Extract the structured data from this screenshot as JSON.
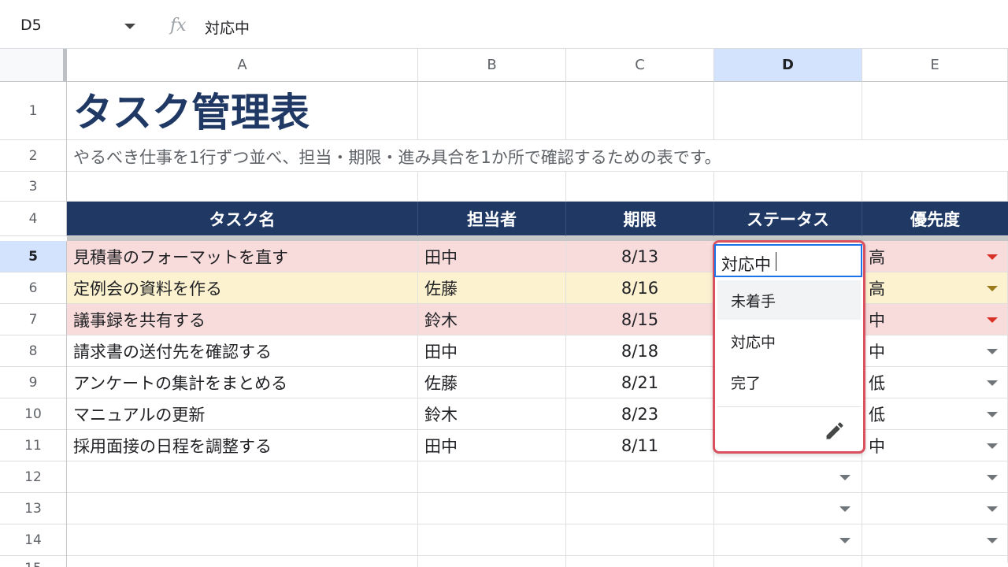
{
  "formula_bar": {
    "cell_ref": "D5",
    "fx_icon": "fx",
    "value": "対応中"
  },
  "columns": [
    "A",
    "B",
    "C",
    "D",
    "E"
  ],
  "selected_column": "D",
  "rows": [
    "1",
    "2",
    "3",
    "4",
    "5",
    "6",
    "7",
    "8",
    "9",
    "10",
    "11",
    "12",
    "13",
    "14",
    "15"
  ],
  "selected_row": "5",
  "sheet": {
    "title": "タスク管理表",
    "description": "やるべき仕事を1行ずつ並べ、担当・期限・進み具合を1か所で確認するための表です。",
    "headers": {
      "task": "タスク名",
      "owner": "担当者",
      "due": "期限",
      "status": "ステータス",
      "priority": "優先度"
    },
    "tasks": [
      {
        "task": "見積書のフォーマットを直す",
        "owner": "田中",
        "due": "8/13",
        "status": "",
        "priority": "高",
        "highlight": "pink"
      },
      {
        "task": "定例会の資料を作る",
        "owner": "佐藤",
        "due": "8/16",
        "status": "",
        "priority": "高",
        "highlight": "yellow"
      },
      {
        "task": "議事録を共有する",
        "owner": "鈴木",
        "due": "8/15",
        "status": "",
        "priority": "中",
        "highlight": "pink"
      },
      {
        "task": "請求書の送付先を確認する",
        "owner": "田中",
        "due": "8/18",
        "status": "",
        "priority": "中",
        "highlight": "none"
      },
      {
        "task": "アンケートの集計をまとめる",
        "owner": "佐藤",
        "due": "8/21",
        "status": "",
        "priority": "低",
        "highlight": "none"
      },
      {
        "task": "マニュアルの更新",
        "owner": "鈴木",
        "due": "8/23",
        "status": "",
        "priority": "低",
        "highlight": "none"
      },
      {
        "task": "採用面接の日程を調整する",
        "owner": "田中",
        "due": "8/11",
        "status": "",
        "priority": "中",
        "highlight": "none"
      }
    ]
  },
  "active_cell": {
    "ref": "D5",
    "value": "対応中"
  },
  "status_dropdown": {
    "options": [
      "未着手",
      "対応中",
      "完了"
    ],
    "hovered": "未着手",
    "edit_icon": "pencil-icon"
  },
  "colors": {
    "header_bg": "#1f3864",
    "row_high_pink": "#f8dcdc",
    "row_yellow": "#fdf2d0",
    "selection_blue": "#1a73e8",
    "popup_border": "#d9505f"
  }
}
